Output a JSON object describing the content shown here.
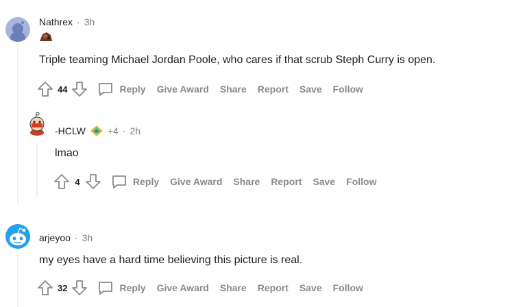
{
  "comments": [
    {
      "username": "Nathrex",
      "time": "3h",
      "text": "Triple teaming Michael Jordan Poole, who cares if that scrub Steph Curry is open.",
      "score": "44"
    },
    {
      "username": "-HCLW",
      "flair": "+4",
      "time": "2h",
      "text": "lmao",
      "score": "4"
    },
    {
      "username": "arjeyoo",
      "time": "3h",
      "text": "my eyes have a hard time believing this picture is real.",
      "score": "32"
    }
  ],
  "actions": {
    "reply": "Reply",
    "give_award": "Give Award",
    "share": "Share",
    "report": "Report",
    "save": "Save",
    "follow": "Follow"
  },
  "separator": "·",
  "colors": {
    "meta_gray": "#7c7c7c",
    "action_gray": "#878a8c",
    "thread_line": "#edeff1",
    "avatar1_bg": "#a5b4e0",
    "avatar3_bg": "#24a0ed"
  },
  "icons": [
    "upvote-icon",
    "downvote-icon",
    "comment-bubble-icon",
    "snoo-avatar-icon",
    "flair-icon",
    "award-icon"
  ]
}
